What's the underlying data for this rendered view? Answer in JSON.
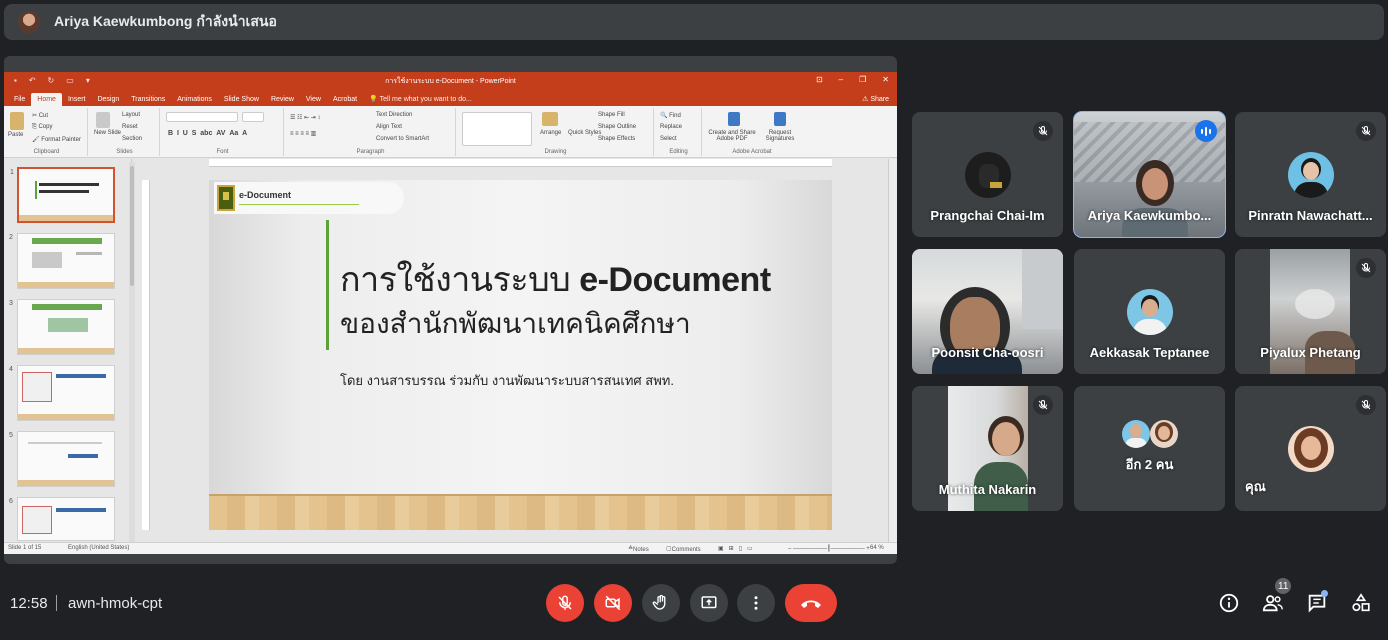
{
  "presenter_bar": {
    "text": "Ariya Kaewkumbong กำลังนำเสนอ"
  },
  "powerpoint": {
    "window_title": "การใช้งานระบบ e-Document - PowerPoint",
    "tabs": [
      "File",
      "Home",
      "Insert",
      "Design",
      "Transitions",
      "Animations",
      "Slide Show",
      "Review",
      "View",
      "Acrobat"
    ],
    "active_tab": "Home",
    "tell_me": "Tell me what you want to do...",
    "share": "Share",
    "ribbon": {
      "clipboard": {
        "label": "Clipboard",
        "paste": "Paste",
        "cut": "Cut",
        "copy": "Copy",
        "format_painter": "Format Painter"
      },
      "slides": {
        "label": "Slides",
        "new_slide": "New Slide",
        "layout": "Layout",
        "reset": "Reset",
        "section": "Section"
      },
      "font": {
        "label": "Font"
      },
      "paragraph": {
        "label": "Paragraph",
        "text_direction": "Text Direction",
        "align_text": "Align Text",
        "convert_smartart": "Convert to SmartArt"
      },
      "drawing": {
        "label": "Drawing",
        "arrange": "Arrange",
        "quick_styles": "Quick Styles",
        "shape_fill": "Shape Fill",
        "shape_outline": "Shape Outline",
        "shape_effects": "Shape Effects"
      },
      "editing": {
        "label": "Editing",
        "find": "Find",
        "replace": "Replace",
        "select": "Select"
      },
      "adobe": {
        "label": "Adobe Acrobat",
        "create_share": "Create and Share Adobe PDF",
        "request_signatures": "Request Signatures"
      }
    },
    "thumbnails": [
      "1",
      "2",
      "3",
      "4",
      "5",
      "6"
    ],
    "slide": {
      "badge": "e-Document",
      "title_thai": "การใช้งานระบบ ",
      "title_en": "e-Document",
      "title_line2": "ของสำนักพัฒนาเทคนิคศึกษา",
      "subtitle": "โดย งานสารบรรณ ร่วมกับ งานพัฒนาระบบสารสนเทศ สพท."
    },
    "status": {
      "slide_of": "Slide 1 of 15",
      "language": "English (United States)",
      "notes": "Notes",
      "comments": "Comments",
      "zoom": "64 %"
    }
  },
  "participants": [
    {
      "name": "Prangchai Chai-Im",
      "muted": true,
      "kind": "avatar"
    },
    {
      "name": "Ariya Kaewkumbo...",
      "muted": false,
      "speaking": true,
      "kind": "video"
    },
    {
      "name": "Pinratn Nawachatt...",
      "muted": true,
      "kind": "avatar"
    },
    {
      "name": "Poonsit Cha-oosri",
      "muted": false,
      "kind": "video"
    },
    {
      "name": "Aekkasak Teptanee",
      "muted": false,
      "kind": "avatar"
    },
    {
      "name": "Piyalux Phetang",
      "muted": true,
      "kind": "video"
    },
    {
      "name": "Muthita Nakarin",
      "muted": true,
      "kind": "video"
    },
    {
      "name": "อีก 2 คน",
      "muted": false,
      "kind": "group"
    },
    {
      "name": "คุณ",
      "muted": true,
      "kind": "avatar"
    }
  ],
  "bottom_bar": {
    "time": "12:58",
    "meeting_code": "awn-hmok-cpt",
    "people_count": "11",
    "controls": [
      "mic-off-icon",
      "camera-off-icon",
      "raise-hand-icon",
      "present-icon",
      "more-options-icon",
      "end-call-icon"
    ],
    "right_controls": [
      "info-icon",
      "people-icon",
      "chat-icon",
      "activities-icon"
    ]
  },
  "colors": {
    "meet_bg": "#202124",
    "tile_bg": "#3c4043",
    "accent_blue": "#8ab4f8",
    "danger_red": "#ea4335",
    "ppt_orange": "#c43e1c",
    "slide_green": "#5da13a"
  }
}
